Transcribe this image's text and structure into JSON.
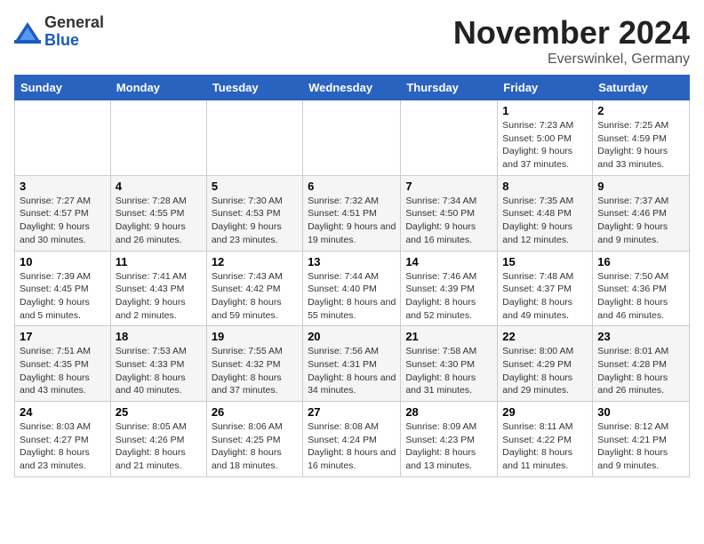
{
  "logo": {
    "general": "General",
    "blue": "Blue"
  },
  "header": {
    "month": "November 2024",
    "location": "Everswinkel, Germany"
  },
  "weekdays": [
    "Sunday",
    "Monday",
    "Tuesday",
    "Wednesday",
    "Thursday",
    "Friday",
    "Saturday"
  ],
  "weeks": [
    [
      {
        "day": "",
        "info": ""
      },
      {
        "day": "",
        "info": ""
      },
      {
        "day": "",
        "info": ""
      },
      {
        "day": "",
        "info": ""
      },
      {
        "day": "",
        "info": ""
      },
      {
        "day": "1",
        "info": "Sunrise: 7:23 AM\nSunset: 5:00 PM\nDaylight: 9 hours and 37 minutes."
      },
      {
        "day": "2",
        "info": "Sunrise: 7:25 AM\nSunset: 4:59 PM\nDaylight: 9 hours and 33 minutes."
      }
    ],
    [
      {
        "day": "3",
        "info": "Sunrise: 7:27 AM\nSunset: 4:57 PM\nDaylight: 9 hours and 30 minutes."
      },
      {
        "day": "4",
        "info": "Sunrise: 7:28 AM\nSunset: 4:55 PM\nDaylight: 9 hours and 26 minutes."
      },
      {
        "day": "5",
        "info": "Sunrise: 7:30 AM\nSunset: 4:53 PM\nDaylight: 9 hours and 23 minutes."
      },
      {
        "day": "6",
        "info": "Sunrise: 7:32 AM\nSunset: 4:51 PM\nDaylight: 9 hours and 19 minutes."
      },
      {
        "day": "7",
        "info": "Sunrise: 7:34 AM\nSunset: 4:50 PM\nDaylight: 9 hours and 16 minutes."
      },
      {
        "day": "8",
        "info": "Sunrise: 7:35 AM\nSunset: 4:48 PM\nDaylight: 9 hours and 12 minutes."
      },
      {
        "day": "9",
        "info": "Sunrise: 7:37 AM\nSunset: 4:46 PM\nDaylight: 9 hours and 9 minutes."
      }
    ],
    [
      {
        "day": "10",
        "info": "Sunrise: 7:39 AM\nSunset: 4:45 PM\nDaylight: 9 hours and 5 minutes."
      },
      {
        "day": "11",
        "info": "Sunrise: 7:41 AM\nSunset: 4:43 PM\nDaylight: 9 hours and 2 minutes."
      },
      {
        "day": "12",
        "info": "Sunrise: 7:43 AM\nSunset: 4:42 PM\nDaylight: 8 hours and 59 minutes."
      },
      {
        "day": "13",
        "info": "Sunrise: 7:44 AM\nSunset: 4:40 PM\nDaylight: 8 hours and 55 minutes."
      },
      {
        "day": "14",
        "info": "Sunrise: 7:46 AM\nSunset: 4:39 PM\nDaylight: 8 hours and 52 minutes."
      },
      {
        "day": "15",
        "info": "Sunrise: 7:48 AM\nSunset: 4:37 PM\nDaylight: 8 hours and 49 minutes."
      },
      {
        "day": "16",
        "info": "Sunrise: 7:50 AM\nSunset: 4:36 PM\nDaylight: 8 hours and 46 minutes."
      }
    ],
    [
      {
        "day": "17",
        "info": "Sunrise: 7:51 AM\nSunset: 4:35 PM\nDaylight: 8 hours and 43 minutes."
      },
      {
        "day": "18",
        "info": "Sunrise: 7:53 AM\nSunset: 4:33 PM\nDaylight: 8 hours and 40 minutes."
      },
      {
        "day": "19",
        "info": "Sunrise: 7:55 AM\nSunset: 4:32 PM\nDaylight: 8 hours and 37 minutes."
      },
      {
        "day": "20",
        "info": "Sunrise: 7:56 AM\nSunset: 4:31 PM\nDaylight: 8 hours and 34 minutes."
      },
      {
        "day": "21",
        "info": "Sunrise: 7:58 AM\nSunset: 4:30 PM\nDaylight: 8 hours and 31 minutes."
      },
      {
        "day": "22",
        "info": "Sunrise: 8:00 AM\nSunset: 4:29 PM\nDaylight: 8 hours and 29 minutes."
      },
      {
        "day": "23",
        "info": "Sunrise: 8:01 AM\nSunset: 4:28 PM\nDaylight: 8 hours and 26 minutes."
      }
    ],
    [
      {
        "day": "24",
        "info": "Sunrise: 8:03 AM\nSunset: 4:27 PM\nDaylight: 8 hours and 23 minutes."
      },
      {
        "day": "25",
        "info": "Sunrise: 8:05 AM\nSunset: 4:26 PM\nDaylight: 8 hours and 21 minutes."
      },
      {
        "day": "26",
        "info": "Sunrise: 8:06 AM\nSunset: 4:25 PM\nDaylight: 8 hours and 18 minutes."
      },
      {
        "day": "27",
        "info": "Sunrise: 8:08 AM\nSunset: 4:24 PM\nDaylight: 8 hours and 16 minutes."
      },
      {
        "day": "28",
        "info": "Sunrise: 8:09 AM\nSunset: 4:23 PM\nDaylight: 8 hours and 13 minutes."
      },
      {
        "day": "29",
        "info": "Sunrise: 8:11 AM\nSunset: 4:22 PM\nDaylight: 8 hours and 11 minutes."
      },
      {
        "day": "30",
        "info": "Sunrise: 8:12 AM\nSunset: 4:21 PM\nDaylight: 8 hours and 9 minutes."
      }
    ]
  ]
}
